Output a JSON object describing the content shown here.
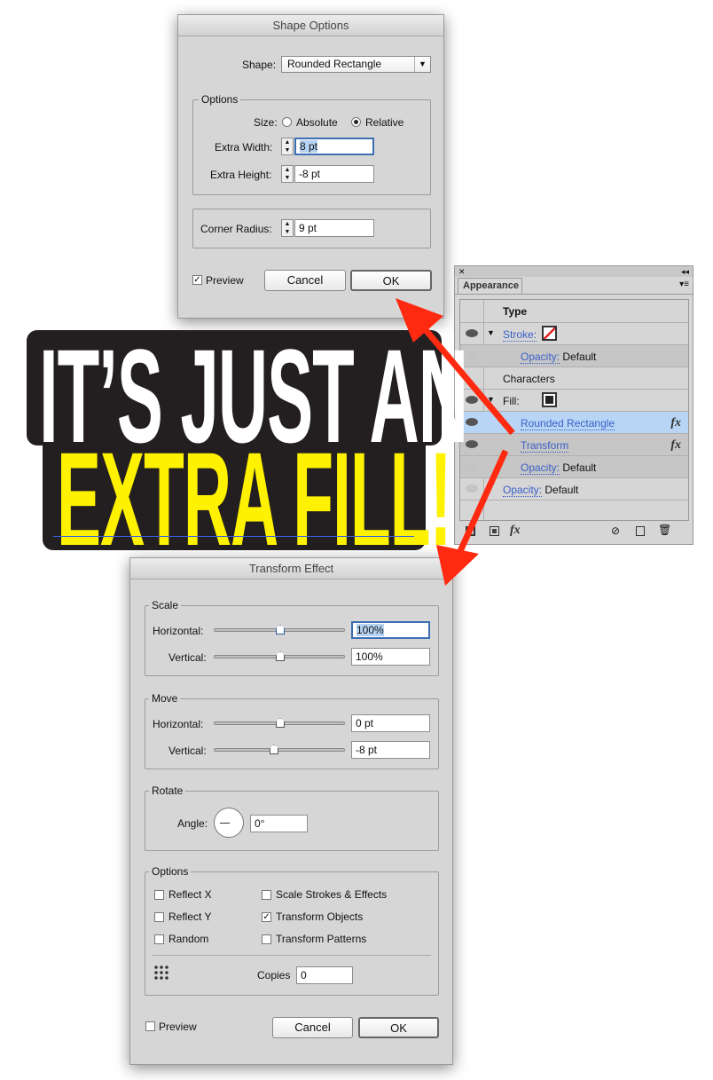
{
  "shape_options": {
    "title": "Shape Options",
    "shape_label": "Shape:",
    "shape_value": "Rounded Rectangle",
    "options_group": "Options",
    "size_label": "Size:",
    "absolute": "Absolute",
    "relative": "Relative",
    "size_mode": "Relative",
    "extra_width_label": "Extra Width:",
    "extra_width": "8 pt",
    "extra_height_label": "Extra Height:",
    "extra_height": "-8 pt",
    "corner_radius_label": "Corner Radius:",
    "corner_radius": "9 pt",
    "preview": "Preview",
    "preview_checked": true,
    "cancel": "Cancel",
    "ok": "OK"
  },
  "appearance": {
    "tab": "Appearance",
    "rows": [
      {
        "label": "Type"
      },
      {
        "label": "Stroke:",
        "link": true
      },
      {
        "label": "Opacity:",
        "value": "Default"
      },
      {
        "label": "Characters"
      },
      {
        "label": "Fill:"
      },
      {
        "label": "Rounded Rectangle",
        "fx": "fx",
        "selected": true
      },
      {
        "label": "Transform",
        "fx": "fx"
      },
      {
        "label": "Opacity:",
        "value": "Default"
      },
      {
        "label": "Opacity:",
        "value": "Default"
      }
    ],
    "footer_fx": "fx"
  },
  "banner": {
    "line1": "IT’S JUST AN",
    "line2": "EXTRA FILL!",
    "line1_color": "#ffffff",
    "line2_color": "#fff200",
    "background": "#231f20"
  },
  "transform": {
    "title": "Transform Effect",
    "scale_group": "Scale",
    "horizontal": "Horizontal:",
    "vertical": "Vertical:",
    "scale_h": "100%",
    "scale_v": "100%",
    "move_group": "Move",
    "move_h": "0 pt",
    "move_v": "-8 pt",
    "rotate_group": "Rotate",
    "angle_label": "Angle:",
    "angle": "0°",
    "options_group": "Options",
    "reflect_x": "Reflect X",
    "reflect_y": "Reflect Y",
    "random": "Random",
    "scale_strokes": "Scale Strokes & Effects",
    "transform_objects": "Transform Objects",
    "transform_patterns": "Transform Patterns",
    "copies_label": "Copies",
    "copies": "0",
    "preview": "Preview",
    "cancel": "Cancel",
    "ok": "OK"
  },
  "colors": {
    "arrow": "#ff2a10",
    "selection": "#b8d5f5",
    "link": "#3a5fc8"
  }
}
